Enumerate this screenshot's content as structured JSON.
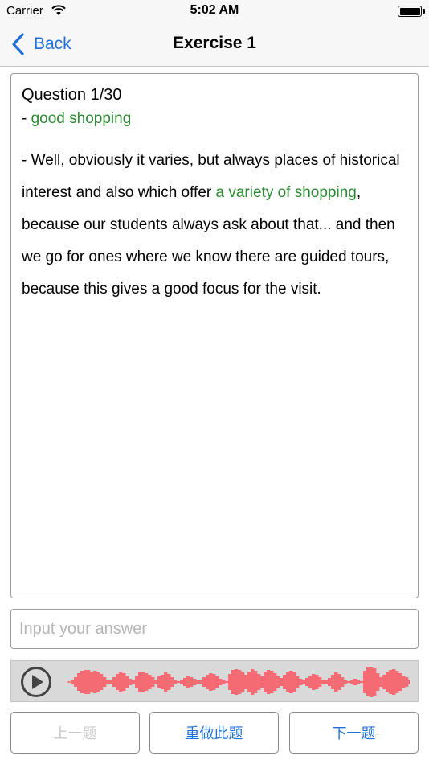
{
  "status_bar": {
    "carrier": "Carrier",
    "time": "5:02 AM"
  },
  "nav": {
    "back_label": "Back",
    "title": "Exercise 1"
  },
  "question": {
    "header": "Question 1/30",
    "keyword_prefix": "- ",
    "keyword": "good shopping",
    "text_part1": "- Well, obviously it varies, but always places of historical interest and also which offer ",
    "highlight": "a variety of shopping",
    "text_part2": ", because our students always ask about that... and then we go for ones where we know there are guided tours, because this gives a good focus for the visit."
  },
  "answer": {
    "placeholder": "Input your answer",
    "value": ""
  },
  "player": {
    "icon": "play-circle-icon",
    "accent_color": "#f46b73"
  },
  "buttons": {
    "prev_label": "上一题",
    "redo_label": "重做此题",
    "next_label": "下一题"
  },
  "colors": {
    "accent": "#1f6fd8",
    "highlight": "#2c8a34",
    "disabled": "#c8c8c8"
  }
}
